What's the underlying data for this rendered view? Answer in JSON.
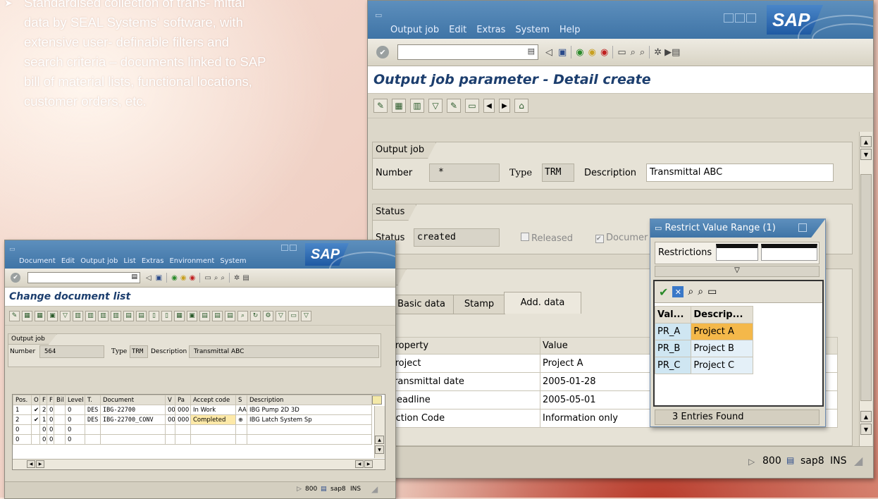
{
  "blurb": {
    "bullet_icon": "arrow-right",
    "text": "Standardised collection of trans- mittal data by SEAL Systems‘ software, with extensive user- definable filters and search criteria – documents linked to SAP bill of material lists, functional locations, customer orders, etc."
  },
  "main_window": {
    "menu": [
      "Output job",
      "Edit",
      "Extras",
      "System",
      "Help"
    ],
    "logo": "SAP",
    "title": "Output job parameter - Detail create",
    "output_job": {
      "group_label": "Output job",
      "number_label": "Number",
      "number_value": "*",
      "type_label": "Type",
      "type_value": "TRM",
      "description_label": "Description",
      "description_value": "Transmittal ABC"
    },
    "status": {
      "group_label": "Status",
      "status_label": "Status",
      "status_value": "created",
      "released_label": "Released",
      "documents_label": "Documer"
    },
    "output": {
      "group_label": "tput",
      "tabs": [
        "Basic data",
        "Stamp",
        "Add. data"
      ],
      "active_tab": 2,
      "table": {
        "columns": [
          "Property",
          "Value"
        ],
        "rows": [
          [
            "Project",
            "Project A"
          ],
          [
            "Transmittal date",
            "2005-01-28"
          ],
          [
            "Deadline",
            "2005-05-01"
          ],
          [
            "Action Code",
            "Information only"
          ]
        ]
      }
    },
    "statusbar": {
      "client": "800",
      "server": "sap8",
      "mode": "INS"
    }
  },
  "popup": {
    "title": "Restrict Value Range (1)",
    "restrictions_label": "Restrictions",
    "columns": [
      "Val...",
      "Descrip..."
    ],
    "rows": [
      [
        "PR_A",
        "Project A"
      ],
      [
        "PR_B",
        "Project B"
      ],
      [
        "PR_C",
        "Project C"
      ]
    ],
    "selected_row": 0,
    "footer": "3 Entries Found"
  },
  "small_window": {
    "menu": [
      "Document",
      "Edit",
      "Output job",
      "List",
      "Extras",
      "Environment",
      "System"
    ],
    "logo": "SAP",
    "title": "Change document list",
    "output_job": {
      "group_label": "Output job",
      "number_label": "Number",
      "number_value": "564",
      "type_label": "Type",
      "type_value": "TRM",
      "description_label": "Description",
      "description_value": "Transmittal ABC"
    },
    "table": {
      "columns": [
        "Pos.",
        "O",
        "F",
        "F",
        "Bil",
        "Level",
        "T.",
        "Document",
        "V",
        "Pa",
        "Accept code",
        "S",
        "Description"
      ],
      "rows": [
        [
          "1",
          "✔",
          "2",
          "0",
          "",
          "0",
          "DES",
          "IBG-22700",
          "00",
          "000",
          "In Work",
          "AA",
          "IBG Pump 2D 3D"
        ],
        [
          "2",
          "✔",
          "1",
          "0",
          "",
          "0",
          "DES",
          "IBG-22700_CONV",
          "00",
          "000",
          "Completed",
          "",
          "IBG Latch System Sp"
        ],
        [
          "0",
          "",
          "0",
          "0",
          "",
          "0",
          "",
          "",
          "",
          "",
          "",
          "",
          ""
        ],
        [
          "0",
          "",
          "0",
          "0",
          "",
          "0",
          "",
          "",
          "",
          "",
          "",
          "",
          ""
        ]
      ]
    },
    "statusbar": {
      "client": "800",
      "server": "sap8",
      "mode": "INS"
    }
  }
}
